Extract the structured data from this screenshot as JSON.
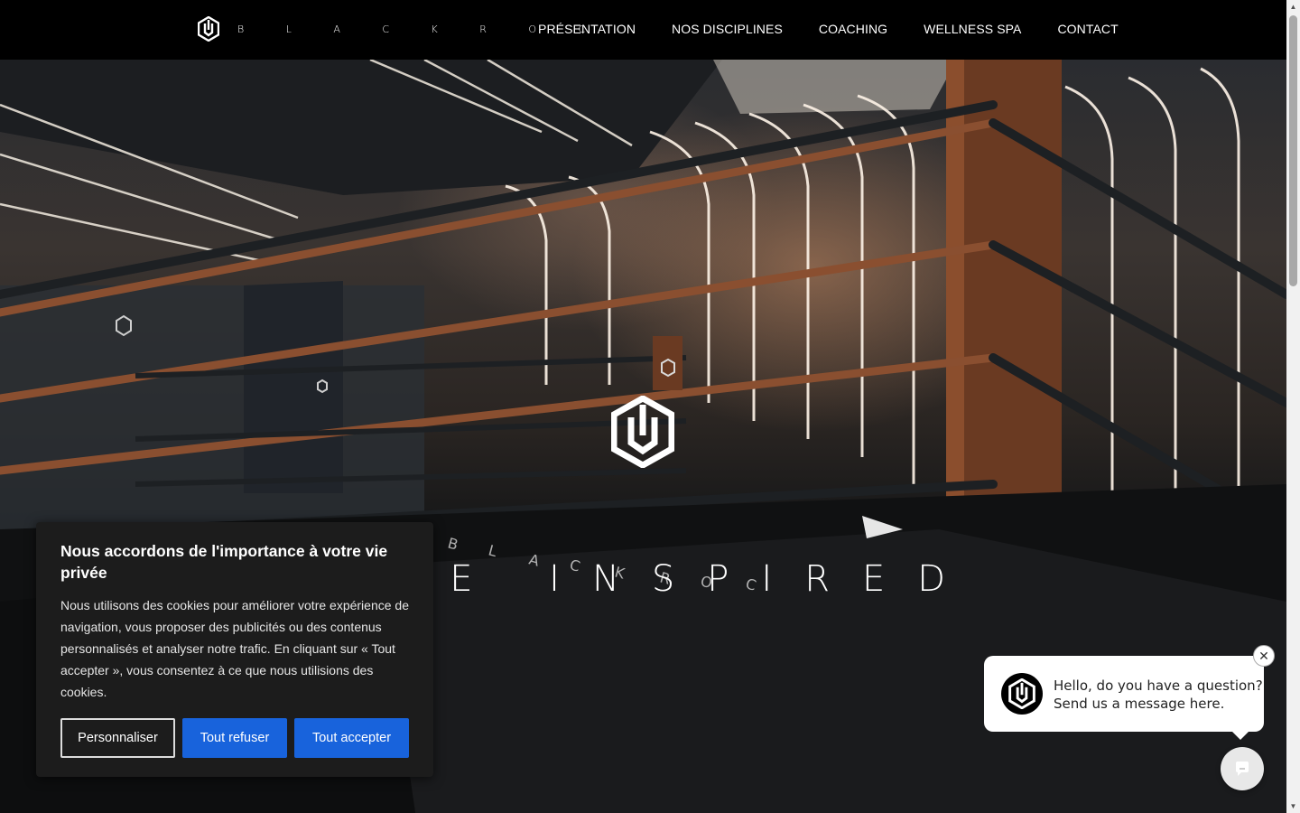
{
  "header": {
    "brand": "B L A C K R O C",
    "nav": [
      "PRÉSENTATION",
      "NOS DISCIPLINES",
      "COACHING",
      "WELLNESS SPA",
      "CONTACT"
    ]
  },
  "hero": {
    "title": "BE INSPIRED",
    "floor_text": "B L A C K R O C"
  },
  "cookie_banner": {
    "title": "Nous accordons de l'importance à votre vie privée",
    "body": "Nous utilisons des cookies pour améliorer votre expérience de navigation, vous proposer des publicités ou des contenus personnalisés et analyser notre trafic. En cliquant sur « Tout accepter », vous consentez à ce que nous utilisions des cookies.",
    "customize_label": "Personnaliser",
    "refuse_label": "Tout refuser",
    "accept_label": "Tout accepter"
  },
  "chat": {
    "line1": "Hello, do you have a question?",
    "line2": "Send us a message here."
  },
  "colors": {
    "accent": "#1863dc",
    "header_bg": "#000000",
    "banner_bg": "#1c1c1c"
  },
  "icons": [
    "blackroc-logo-icon",
    "close-icon",
    "chat-icon",
    "scroll-up-icon",
    "scroll-down-icon"
  ]
}
